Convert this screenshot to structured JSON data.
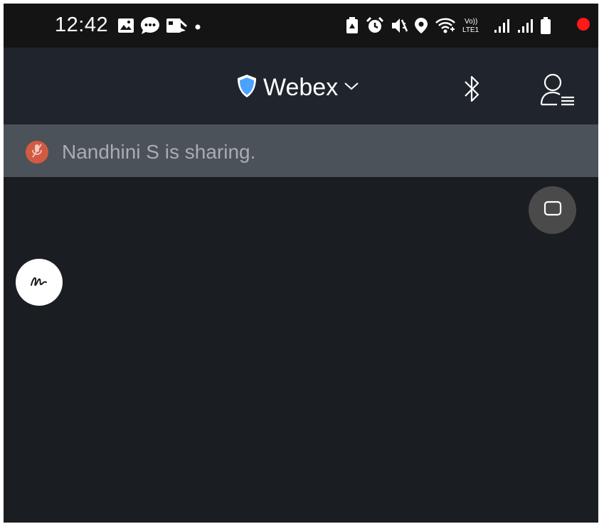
{
  "status_bar": {
    "time": "12:42",
    "left_icons": [
      "gallery-icon",
      "chat-bubble-icon",
      "video-message-icon",
      "dot-icon"
    ],
    "right_icons": [
      "battery-saver-icon",
      "alarm-icon",
      "mute-icon",
      "location-icon",
      "wifi-icon",
      "volte-icon",
      "signal-icon",
      "signal-icon",
      "battery-icon"
    ],
    "volte_label": "Vo))",
    "lte_label": "LTE1"
  },
  "header": {
    "brand_icon": "shield-icon",
    "brand_color": "#4aa3ff",
    "title": "Webex",
    "dropdown_icon": "chevron-down-icon",
    "bluetooth_icon": "bluetooth-icon",
    "profile_icon": "profile-list-icon",
    "notification_color": "#ff1a1a"
  },
  "sharing_banner": {
    "text": "Nandhini S is sharing.",
    "avatar_icon": "muted-mic-icon",
    "avatar_color": "#d35a42"
  },
  "controls": {
    "window_icon": "picture-in-picture-icon",
    "annotate_icon": "annotate-squiggle-icon"
  }
}
